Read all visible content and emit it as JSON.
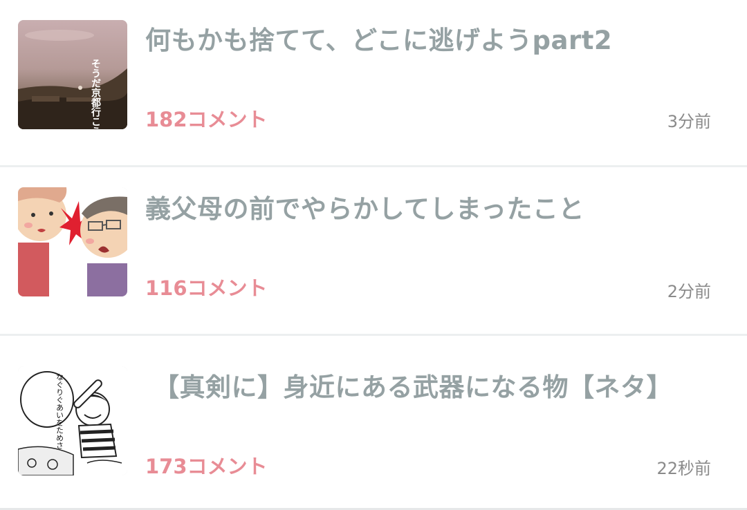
{
  "articles": [
    {
      "title": "何もかも捨てて、どこに逃げようpart2",
      "comments": "182コメント",
      "time": "3分前",
      "thumb": "kyoto-landscape-thumbnail",
      "thumb_text": "そうだ京都行こう。"
    },
    {
      "title": "義父母の前でやらかしてしまったこと",
      "comments": "116コメント",
      "time": "2分前",
      "thumb": "in-law-argument-illustration-thumbnail"
    },
    {
      "title": "【真剣に】身近にある武器になる物【ネタ】",
      "comments": "173コメント",
      "time": "22秒前",
      "thumb": "manga-bat-character-thumbnail",
      "thumb_text": "なぐりぐあいをためさせろ。"
    }
  ],
  "colors": {
    "title": "#95a1a3",
    "comments": "#e88c95",
    "time": "#8a8a8a",
    "divider": "#eceff0"
  }
}
